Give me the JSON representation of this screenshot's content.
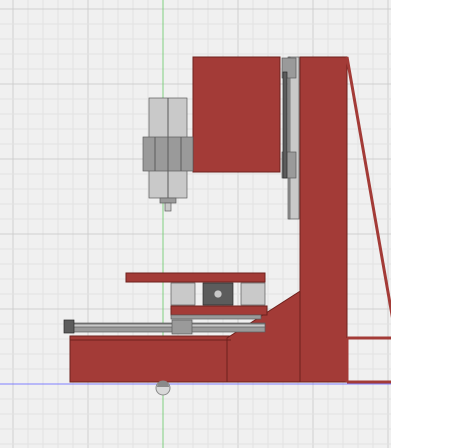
{
  "viewport": {
    "name": "cad-canvas",
    "background": "#f0f0f0",
    "grid_minor_color": "#e2e2e2",
    "grid_major_color": "#cfcfcf",
    "axis_vertical_color": "#7fd07f",
    "axis_horizontal_color": "#7f7fff"
  },
  "model": {
    "name": "cnc-mill-frame",
    "body_color": "#a33b37",
    "body_outline_color": "#6e201c",
    "metal_light": "#c9c9c9",
    "metal_mid": "#9a9a9a",
    "metal_dark": "#5c5c5c",
    "parts": [
      "column",
      "base",
      "gusset",
      "brace",
      "spindle-motor",
      "z-axis-plate",
      "z-rail",
      "work-table",
      "linear-bearings",
      "leadscrew",
      "stepper-motor"
    ]
  },
  "origin_marker": {
    "icon": "origin-icon"
  }
}
